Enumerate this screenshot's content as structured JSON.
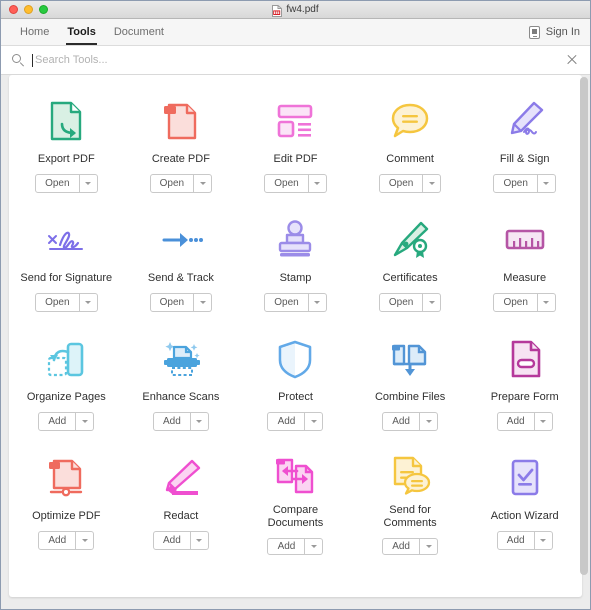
{
  "window": {
    "title": "fw4.pdf",
    "traffic_lights": [
      "close",
      "minimize",
      "zoom"
    ],
    "file_icon": "pdf-file-icon"
  },
  "tabbar": {
    "tabs": [
      {
        "label": "Home",
        "active": false
      },
      {
        "label": "Tools",
        "active": true
      },
      {
        "label": "Document",
        "active": false
      }
    ],
    "sign_in": {
      "label": "Sign In",
      "icon": "device-icon"
    }
  },
  "search": {
    "placeholder": "Search Tools...",
    "value": "",
    "icon": "search-icon",
    "close_icon": "close-icon"
  },
  "tools": [
    {
      "label": "Export PDF",
      "action": "Open",
      "icon": "export-pdf-icon",
      "color": "#27a97e"
    },
    {
      "label": "Create PDF",
      "action": "Open",
      "icon": "create-pdf-icon",
      "color": "#ef6b5e"
    },
    {
      "label": "Edit PDF",
      "action": "Open",
      "icon": "edit-pdf-icon",
      "color": "#ef73d8"
    },
    {
      "label": "Comment",
      "action": "Open",
      "icon": "comment-icon",
      "color": "#f5c63f"
    },
    {
      "label": "Fill & Sign",
      "action": "Open",
      "icon": "fill-and-sign-icon",
      "color": "#8b7be8"
    },
    {
      "label": "Send for Signature",
      "action": "Open",
      "icon": "send-for-signature-icon",
      "color": "#7d6fe8"
    },
    {
      "label": "Send & Track",
      "action": "Open",
      "icon": "send-and-track-icon",
      "color": "#4a90d9"
    },
    {
      "label": "Stamp",
      "action": "Open",
      "icon": "stamp-icon",
      "color": "#9b8ce8"
    },
    {
      "label": "Certificates",
      "action": "Open",
      "icon": "certificates-icon",
      "color": "#27a97e"
    },
    {
      "label": "Measure",
      "action": "Open",
      "icon": "measure-icon",
      "color": "#b555a5"
    },
    {
      "label": "Organize Pages",
      "action": "Add",
      "icon": "organize-pages-icon",
      "color": "#5bc6e0"
    },
    {
      "label": "Enhance Scans",
      "action": "Add",
      "icon": "enhance-scans-icon",
      "color": "#4aa3dd"
    },
    {
      "label": "Protect",
      "action": "Add",
      "icon": "protect-shield-icon",
      "color": "#62a9e8"
    },
    {
      "label": "Combine Files",
      "action": "Add",
      "icon": "combine-files-icon",
      "color": "#5295d6"
    },
    {
      "label": "Prepare Form",
      "action": "Add",
      "icon": "prepare-form-icon",
      "color": "#b5399b"
    },
    {
      "label": "Optimize PDF",
      "action": "Add",
      "icon": "optimize-pdf-icon",
      "color": "#ef6b5e"
    },
    {
      "label": "Redact",
      "action": "Add",
      "icon": "redact-icon",
      "color": "#ef4fd0"
    },
    {
      "label": "Compare Documents",
      "action": "Add",
      "icon": "compare-documents-icon",
      "color": "#ef4fd0"
    },
    {
      "label": "Send for Comments",
      "action": "Add",
      "icon": "send-for-comments-icon",
      "color": "#f5c63f"
    },
    {
      "label": "Action Wizard",
      "action": "Add",
      "icon": "action-wizard-icon",
      "color": "#8b7be8"
    }
  ],
  "dropdown_caret": "chevron-down-icon"
}
